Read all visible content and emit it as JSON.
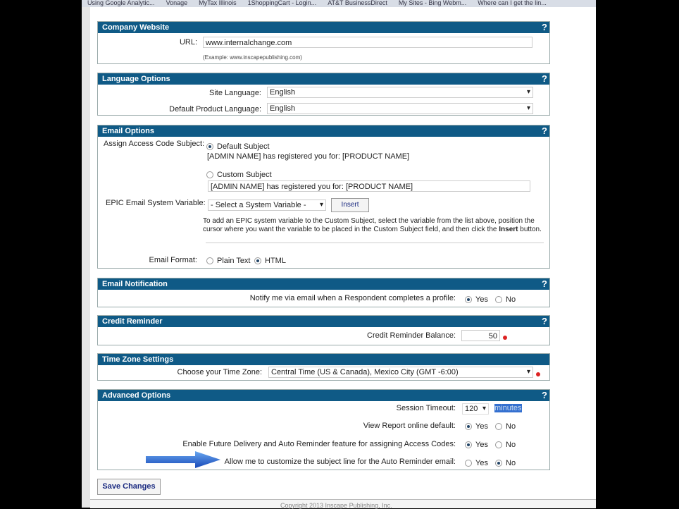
{
  "bookmarks": [
    "Using Google Analytic...",
    "Vonage",
    "MyTax Illinois",
    "1ShoppingCart - Login...",
    "AT&T BusinessDirect",
    "My Sites - Bing Webm...",
    "Where can I get the lin..."
  ],
  "help": "?",
  "company": {
    "title": "Company Website",
    "url_label": "URL:",
    "url_value": "www.internalchange.com",
    "example": "(Example: www.inscapepublishing.com)"
  },
  "language": {
    "title": "Language Options",
    "site_label": "Site Language:",
    "site_value": "English",
    "product_label": "Default Product Language:",
    "product_value": "English"
  },
  "email": {
    "title": "Email Options",
    "subject_label": "Assign Access Code Subject:",
    "default_subject": "Default Subject",
    "default_text": "[ADMIN NAME] has registered you for: [PRODUCT NAME]",
    "custom_subject": "Custom Subject",
    "custom_value": "[ADMIN NAME] has registered you for: [PRODUCT NAME]",
    "variable_label": "EPIC Email System Variable:",
    "variable_select": "- Select a System Variable -",
    "insert": "Insert",
    "help_text_1": "To add an EPIC system variable to the Custom Subject, select the variable from the list above, position the",
    "help_text_2": "cursor where you want the variable to be placed in the Custom Subject field, and then click the",
    "help_bold": "Insert",
    "help_end": "button.",
    "format_label": "Email Format:",
    "plain": "Plain Text",
    "html": "HTML"
  },
  "notification": {
    "title": "Email Notification",
    "label": "Notify me via email when a Respondent completes a profile:",
    "yes": "Yes",
    "no": "No"
  },
  "credit": {
    "title": "Credit Reminder",
    "label": "Credit Reminder Balance:",
    "value": "50"
  },
  "timezone": {
    "title": "Time Zone Settings",
    "label": "Choose your Time Zone:",
    "value": "Central Time (US & Canada), Mexico City (GMT -6:00)"
  },
  "advanced": {
    "title": "Advanced Options",
    "timeout_label": "Session Timeout:",
    "timeout_value": "120",
    "timeout_unit": "minutes",
    "report_label": "View Report online default:",
    "future_label": "Enable Future Delivery and Auto Reminder feature for assigning Access Codes:",
    "custom_label": "Allow me to customize the subject line for the Auto Reminder email:",
    "yes": "Yes",
    "no": "No"
  },
  "save": "Save Changes",
  "footer": "Copyright 2013 Inscape Publishing, Inc."
}
